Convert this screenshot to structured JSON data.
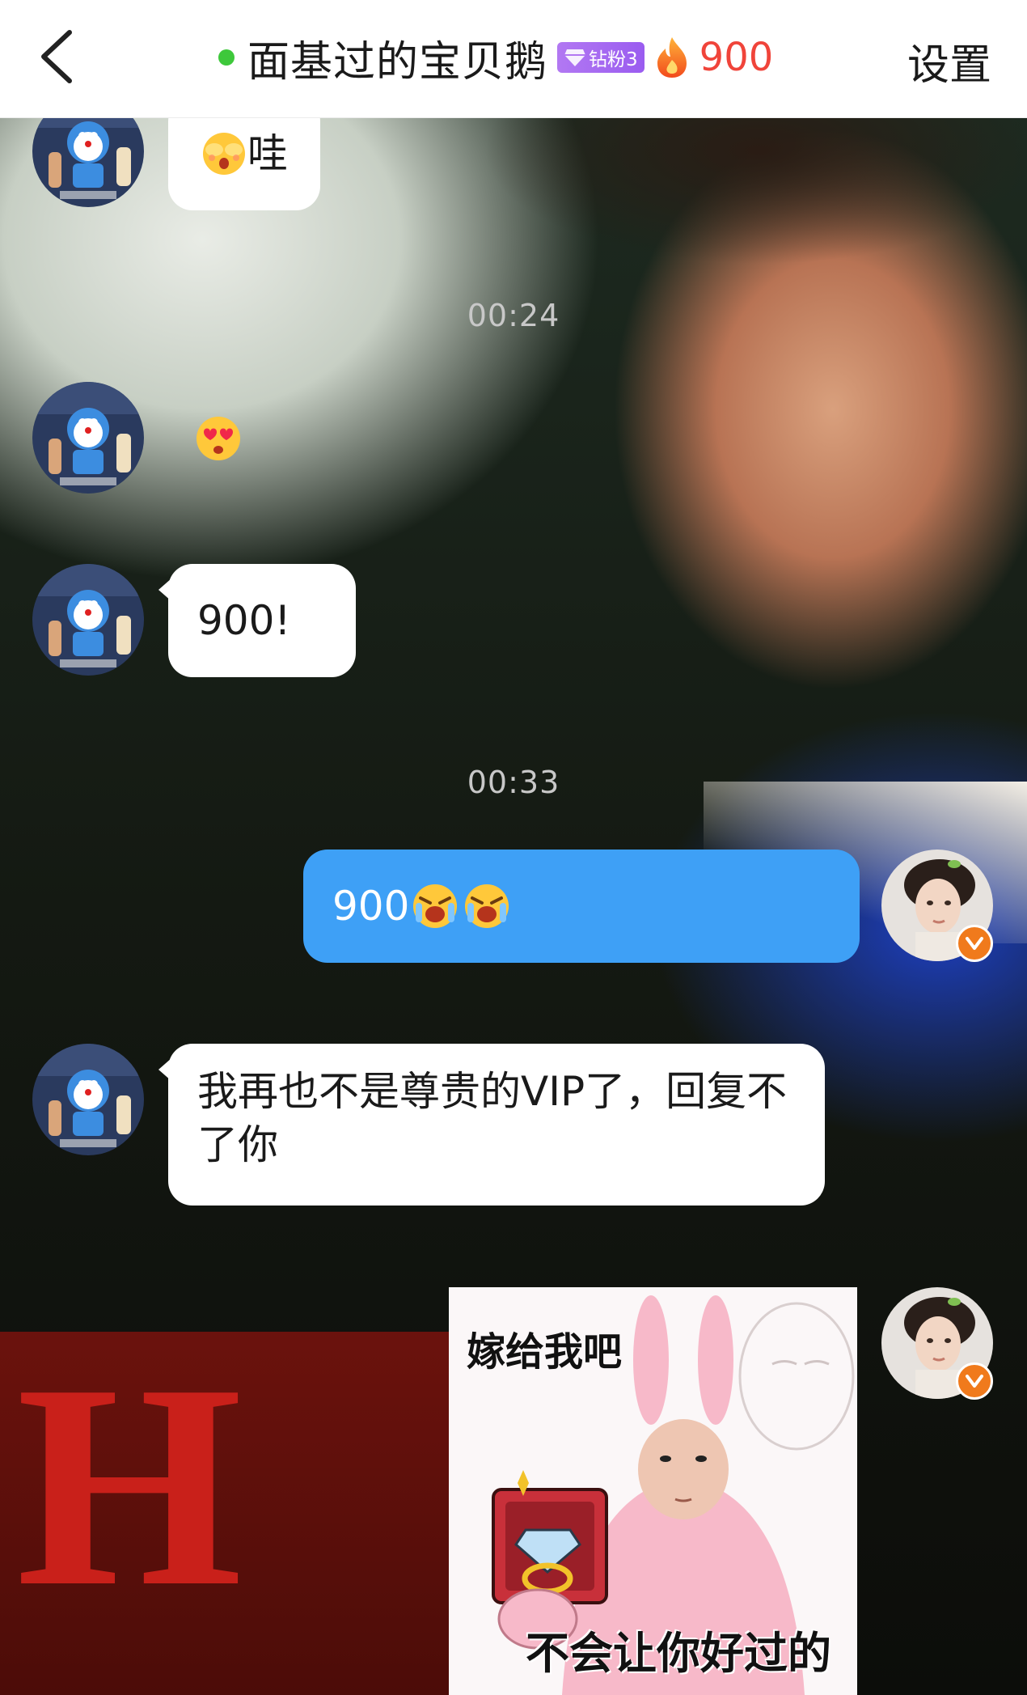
{
  "header": {
    "back_icon": "chevron-left-icon",
    "title": "面基过的宝贝鹅",
    "online_status_color": "#3ec83b",
    "fan_badge": {
      "icon": "diamond-icon",
      "label": "钻粉3"
    },
    "fire_icon": "fire-icon",
    "fire_count": "900",
    "settings_label": "设置"
  },
  "messages": [
    {
      "sender": "other",
      "type": "text",
      "text": "哇",
      "emoji": "shy-face"
    },
    {
      "type": "timestamp",
      "text": "00:24"
    },
    {
      "sender": "other",
      "type": "emoji",
      "emoji": "heart-eyes-face"
    },
    {
      "sender": "other",
      "type": "text",
      "text": "900!"
    },
    {
      "type": "timestamp",
      "text": "00:33"
    },
    {
      "sender": "self",
      "type": "text",
      "text": "900",
      "emoji": "crying-face x2"
    },
    {
      "sender": "other",
      "type": "text",
      "text": "我再也不是尊贵的VIP了，回复不了你"
    },
    {
      "sender": "self",
      "type": "sticker",
      "top_text": "嫁给我吧",
      "bottom_text": "不会让你好过的"
    }
  ],
  "colors": {
    "self_bubble": "#3ea0f6",
    "other_bubble": "#ffffff",
    "fire_count": "#f0443a",
    "fan_badge": "#9a5cf0",
    "verified_badge": "#f07a1c"
  }
}
